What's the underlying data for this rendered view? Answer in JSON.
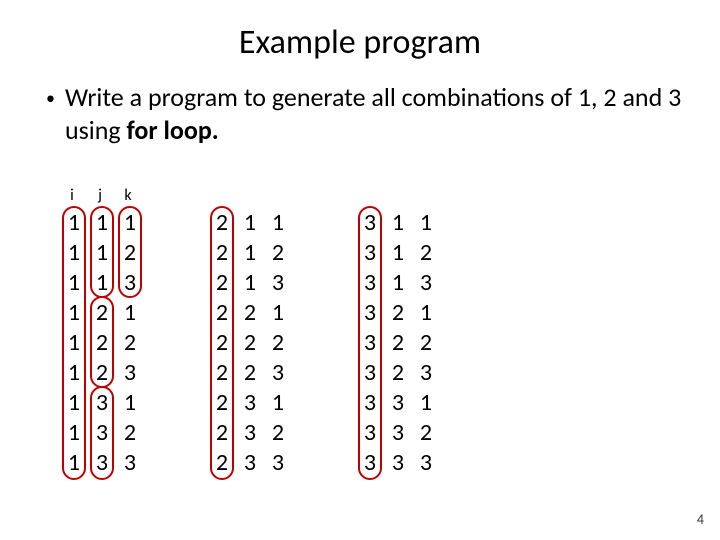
{
  "title": "Example program",
  "bullet": {
    "part1": "Write a program to generate all combinations of 1, 2 and 3 using ",
    "bold": "for loop.",
    "part3": ""
  },
  "headers": {
    "i": "i",
    "j": "j",
    "k": "k"
  },
  "blocks": [
    {
      "i": [
        "1",
        "1",
        "1",
        "1",
        "1",
        "1",
        "1",
        "1",
        "1"
      ],
      "j": [
        "1",
        "1",
        "1",
        "2",
        "2",
        "2",
        "3",
        "3",
        "3"
      ],
      "k": [
        "1",
        "2",
        "3",
        "1",
        "2",
        "3",
        "1",
        "2",
        "3"
      ]
    },
    {
      "i": [
        "2",
        "2",
        "2",
        "2",
        "2",
        "2",
        "2",
        "2",
        "2"
      ],
      "j": [
        "1",
        "1",
        "1",
        "2",
        "2",
        "2",
        "3",
        "3",
        "3"
      ],
      "k": [
        "1",
        "2",
        "3",
        "1",
        "2",
        "3",
        "1",
        "2",
        "3"
      ]
    },
    {
      "i": [
        "3",
        "3",
        "3",
        "3",
        "3",
        "3",
        "3",
        "3",
        "3"
      ],
      "j": [
        "1",
        "1",
        "1",
        "2",
        "2",
        "2",
        "3",
        "3",
        "3"
      ],
      "k": [
        "1",
        "2",
        "3",
        "1",
        "2",
        "3",
        "1",
        "2",
        "3"
      ]
    }
  ],
  "page_number": "4"
}
